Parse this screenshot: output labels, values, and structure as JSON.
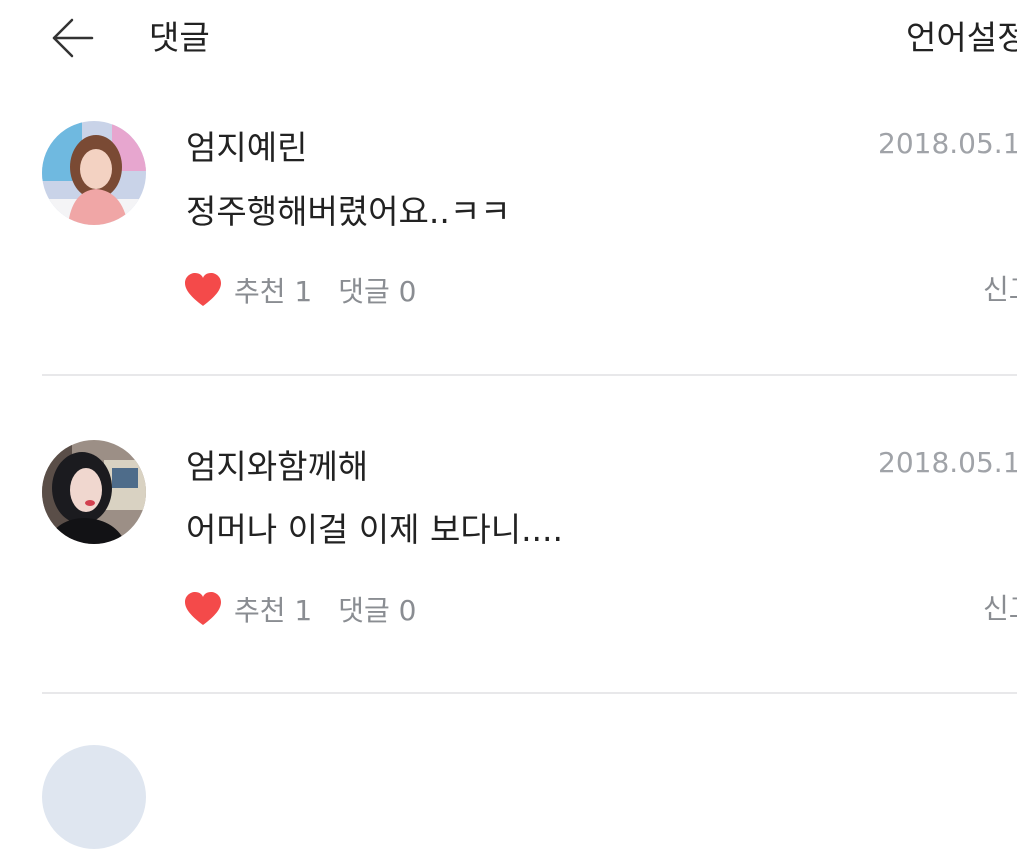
{
  "header": {
    "title": "댓글",
    "language_label": "언어설정"
  },
  "comments": [
    {
      "username": "엄지예린",
      "date": "2018.05.1",
      "text": "정주행해버렸어요..ㅋㅋ",
      "like_label": "추천 1",
      "reply_label": "댓글 0",
      "report_label": "신고"
    },
    {
      "username": "엄지와함께해",
      "date": "2018.05.1",
      "text": "어머나 이걸 이제 보다니....",
      "like_label": "추천 1",
      "reply_label": "댓글 0",
      "report_label": "신고"
    }
  ],
  "icons": {
    "back": "arrow-left-icon",
    "like": "heart-icon"
  },
  "colors": {
    "heart": "#f44a4a",
    "meta_text": "#a0a3a8",
    "divider": "#e8e8ea"
  }
}
